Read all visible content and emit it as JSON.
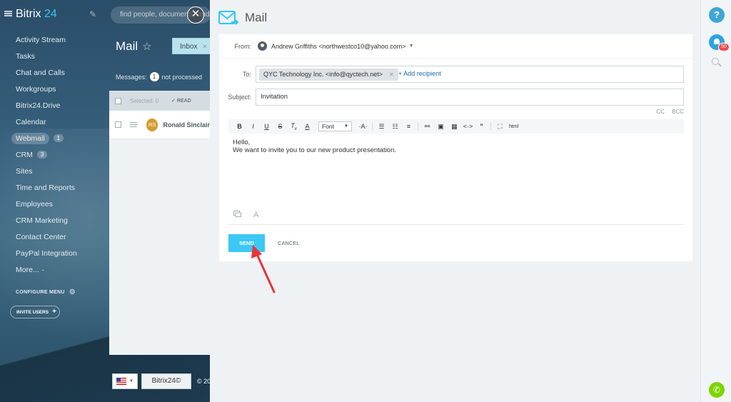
{
  "app": {
    "logo_text": "Bitrix",
    "logo_num": "24",
    "search_placeholder": "find people, documents, and mo"
  },
  "sidebar": {
    "items": [
      {
        "label": "Activity Stream"
      },
      {
        "label": "Tasks"
      },
      {
        "label": "Chat and Calls"
      },
      {
        "label": "Workgroups"
      },
      {
        "label": "Bitrix24.Drive"
      },
      {
        "label": "Calendar"
      },
      {
        "label": "Webmail",
        "count": "1"
      },
      {
        "label": "CRM",
        "count": "3"
      },
      {
        "label": "Sites"
      },
      {
        "label": "Time and Reports"
      },
      {
        "label": "Employees"
      },
      {
        "label": "CRM Marketing"
      },
      {
        "label": "Contact Center"
      },
      {
        "label": "PayPal Integration"
      },
      {
        "label": "More..."
      }
    ],
    "configure_menu": "CONFIGURE MENU",
    "invite_users": "INVITE USERS"
  },
  "mail_bg": {
    "title": "Mail",
    "inbox_tab": "Inbox",
    "messages_label": "Messages:",
    "messages_count": "1",
    "not_processed": "not processed",
    "selected": "Selected: 0",
    "read": "READ",
    "row": {
      "initials": "RS",
      "sender": "Ronald Sinclair"
    },
    "footer_b24": "Bitrix24",
    "footer_copy": "© 20"
  },
  "composer": {
    "title": "Mail",
    "from_label": "From:",
    "from_value": "Andrew Griffiths <northwestco10@yahoo.com>",
    "to_label": "To:",
    "to_chip": "QYC Technology Inc. <info@qyctech.net>",
    "add_recipient": "+ Add recipient",
    "subject_label": "Subject:",
    "subject_value": "Invitation",
    "cc": "CC",
    "bcc": "BCC",
    "font_select": "Font",
    "html_label": "html",
    "body_line1": "Hello,",
    "body_line2": "We want to invite you to our new product presentation.",
    "send": "SEND",
    "cancel": "CANCEL"
  },
  "rightbar": {
    "notif_count": "50"
  },
  "colors": {
    "accent": "#3bc8f5",
    "link": "#2067b0",
    "annotation_arrow": "#e8343b"
  }
}
